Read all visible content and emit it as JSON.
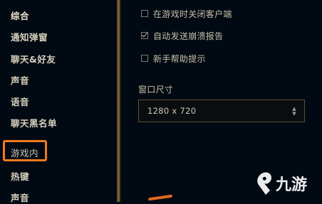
{
  "sidebar": {
    "items": [
      {
        "label": "综合"
      },
      {
        "label": "通知弹窗"
      },
      {
        "label": "聊天&好友"
      },
      {
        "label": "声音"
      },
      {
        "label": "语音"
      },
      {
        "label": "聊天黑名单"
      },
      {
        "label": "游戏内"
      },
      {
        "label": "热键"
      },
      {
        "label": "声音"
      }
    ],
    "active_index": 0,
    "highlighted_index": 6,
    "highlight_color": "#f07a1e"
  },
  "settings": {
    "options": [
      {
        "label": "在游戏时关闭客户端",
        "checked": false
      },
      {
        "label": "自动发送崩溃报告",
        "checked": true
      },
      {
        "label": "新手帮助提示",
        "checked": false
      }
    ],
    "window_size": {
      "label": "窗口尺寸",
      "value": "1280 x 720"
    }
  },
  "watermark": {
    "text": "九游",
    "icon": "jiuyou-logo"
  },
  "colors": {
    "background": "#010a13",
    "gold_divider": "#8a6e3a",
    "text": "#c8c0a8",
    "accent": "#f07a1e"
  }
}
